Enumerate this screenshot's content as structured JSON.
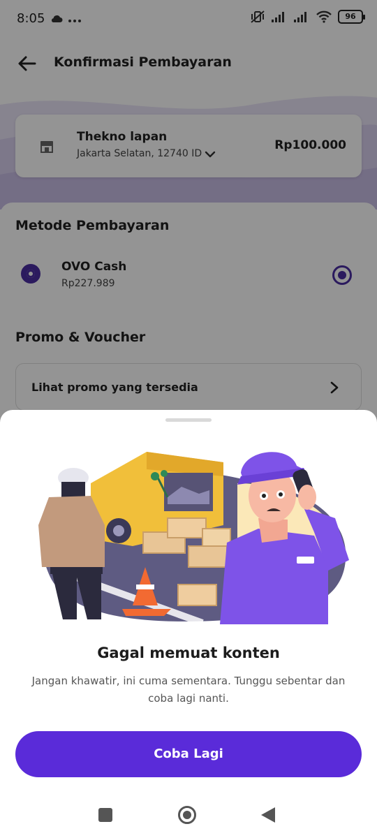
{
  "status_bar": {
    "time": "8:05",
    "left_icons": [
      "cloud-icon",
      "more-dots-icon"
    ],
    "right_icons": [
      "mute-vibrate-icon",
      "signal-icon",
      "signal-icon",
      "wifi-icon"
    ],
    "battery": "96"
  },
  "header": {
    "title": "Konfirmasi Pembayaran",
    "back_icon": "arrow-left-icon"
  },
  "merchant": {
    "name": "Thekno lapan",
    "location": "Jakarta Selatan, 12740 ID",
    "amount": "Rp100.000",
    "icon": "store-icon"
  },
  "payment_method": {
    "section_title": "Metode Pembayaran",
    "option_name": "OVO Cash",
    "option_balance": "Rp227.989",
    "selected": true
  },
  "promo": {
    "section_title": "Promo & Voucher",
    "row_label": "Lihat promo yang tersedia"
  },
  "error_sheet": {
    "illustration": "delivery-failure-illustration",
    "title": "Gagal memuat konten",
    "description": "Jangan khawatir, ini cuma sementara. Tunggu sebentar dan coba lagi nanti.",
    "retry_label": "Coba Lagi"
  },
  "nav_bar": {
    "buttons": [
      "recents-square-icon",
      "home-circle-icon",
      "back-triangle-icon"
    ]
  },
  "colors": {
    "primary": "#5a2bd9",
    "ovo_purple": "#4a2ea3",
    "scrim": "rgba(0,0,0,0.42)"
  }
}
